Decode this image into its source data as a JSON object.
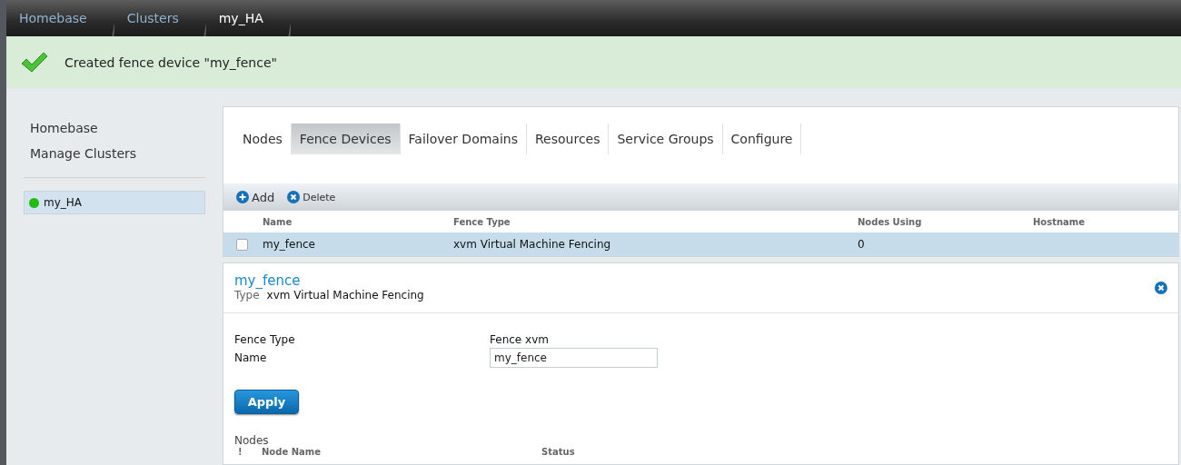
{
  "breadcrumbs": [
    {
      "label": "Homebase",
      "selected": false
    },
    {
      "label": "Clusters",
      "selected": false
    },
    {
      "label": "my_HA",
      "selected": true
    }
  ],
  "notification": {
    "message": "Created fence device \"my_fence\""
  },
  "sidebar": {
    "items": [
      {
        "label": "Homebase"
      },
      {
        "label": "Manage Clusters"
      }
    ],
    "clusters": [
      {
        "name": "my_HA",
        "color": "#22bb11",
        "selected": true
      }
    ]
  },
  "tabs": [
    {
      "label": "Nodes",
      "selected": false
    },
    {
      "label": "Fence Devices",
      "selected": true
    },
    {
      "label": "Failover Domains",
      "selected": false
    },
    {
      "label": "Resources",
      "selected": false
    },
    {
      "label": "Service Groups",
      "selected": false
    },
    {
      "label": "Configure",
      "selected": false
    }
  ],
  "toolbar": [
    {
      "label": "Add",
      "kind": "add"
    },
    {
      "label": "Delete",
      "kind": "delete"
    }
  ],
  "table": {
    "columns": [
      "Name",
      "Fence Type",
      "Nodes Using",
      "Hostname"
    ],
    "rows": [
      {
        "checked": false,
        "selected": true,
        "cells": [
          "my_fence",
          "xvm Virtual Machine Fencing",
          "0"
        ]
      }
    ]
  },
  "detail": {
    "title": "my_fence",
    "type_label": "Type",
    "type_value": "xvm Virtual Machine Fencing",
    "fields": [
      {
        "label": "Fence Type",
        "kind": "text",
        "value": "Fence xvm"
      },
      {
        "label": "Name",
        "kind": "input",
        "value": "my_fence"
      }
    ],
    "apply": "Apply",
    "nodes": {
      "title": "Nodes",
      "columns": [
        "!",
        "Node Name",
        "Status"
      ]
    }
  }
}
